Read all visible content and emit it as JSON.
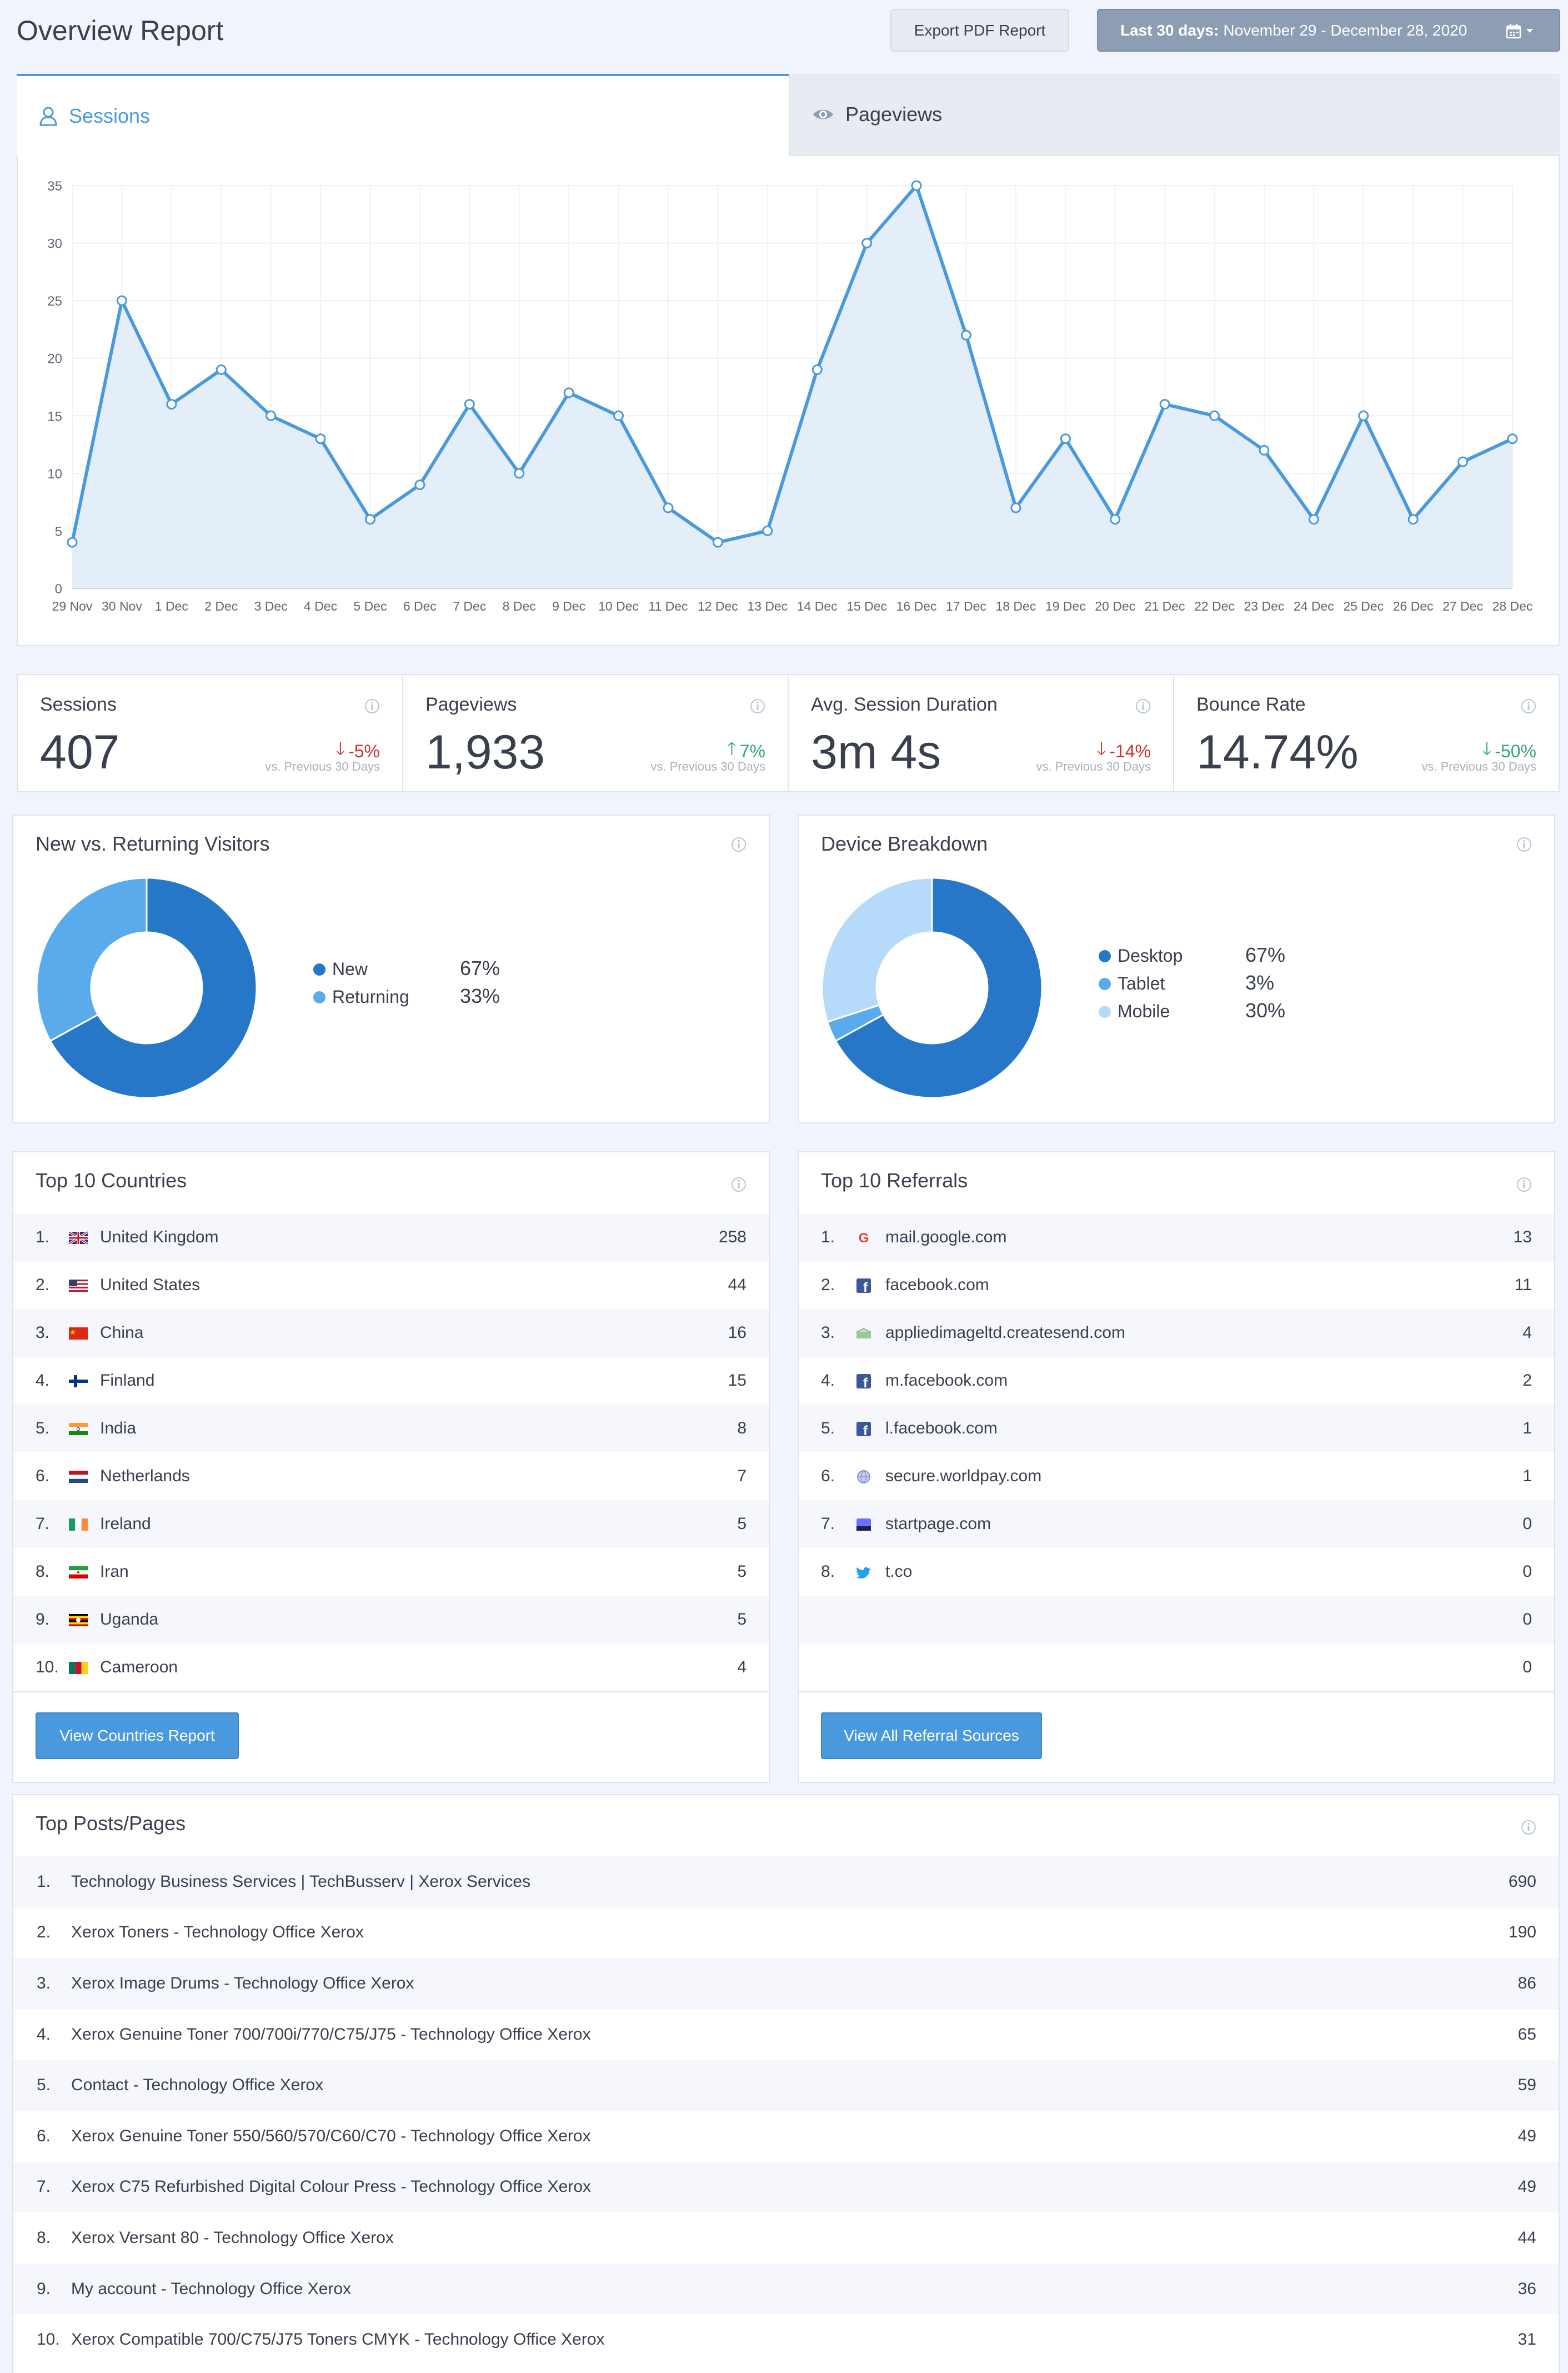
{
  "header": {
    "title": "Overview Report",
    "export_label": "Export PDF Report",
    "range_label": "Last 30 days:",
    "range_value": "November 29 - December 28, 2020"
  },
  "tabs": {
    "sessions": "Sessions",
    "pageviews": "Pageviews"
  },
  "colors": {
    "accent": "#4a99dd",
    "primary_blue": "#2677c7",
    "mid_blue": "#5aabeb",
    "light_blue": "#b6dbfa",
    "down": "#d0312d",
    "up": "#36a673"
  },
  "chart_data": {
    "type": "area",
    "x": [
      "29 Nov",
      "30 Nov",
      "1 Dec",
      "2 Dec",
      "3 Dec",
      "4 Dec",
      "5 Dec",
      "6 Dec",
      "7 Dec",
      "8 Dec",
      "9 Dec",
      "10 Dec",
      "11 Dec",
      "12 Dec",
      "13 Dec",
      "14 Dec",
      "15 Dec",
      "16 Dec",
      "17 Dec",
      "18 Dec",
      "19 Dec",
      "20 Dec",
      "21 Dec",
      "22 Dec",
      "23 Dec",
      "24 Dec",
      "25 Dec",
      "26 Dec",
      "27 Dec",
      "28 Dec"
    ],
    "series": [
      {
        "values": [
          4,
          25,
          16,
          19,
          15,
          13,
          6,
          9,
          16,
          10,
          17,
          15,
          7,
          4,
          5,
          19,
          30,
          35,
          22,
          7,
          13,
          6,
          16,
          15,
          12,
          6,
          15,
          6,
          11,
          13
        ]
      }
    ],
    "yticks": [
      0,
      5,
      10,
      15,
      20,
      25,
      30,
      35
    ],
    "ylim": [
      0,
      35
    ],
    "grid": true
  },
  "stats": [
    {
      "label": "Sessions",
      "value": "407",
      "delta": "-5%",
      "direction": "down",
      "compare": "vs. Previous 30 Days"
    },
    {
      "label": "Pageviews",
      "value": "1,933",
      "delta": "7%",
      "direction": "up",
      "compare": "vs. Previous 30 Days"
    },
    {
      "label": "Avg. Session Duration",
      "value": "3m 4s",
      "delta": "-14%",
      "direction": "down",
      "compare": "vs. Previous 30 Days"
    },
    {
      "label": "Bounce Rate",
      "value": "14.74%",
      "delta": "-50%",
      "direction": "up",
      "compare": "vs. Previous 30 Days"
    }
  ],
  "visitors": {
    "title": "New vs. Returning Visitors",
    "items": [
      {
        "label": "New",
        "value": 67,
        "display": "67%",
        "color": "#2677c7"
      },
      {
        "label": "Returning",
        "value": 33,
        "display": "33%",
        "color": "#5aabeb"
      }
    ]
  },
  "devices": {
    "title": "Device Breakdown",
    "items": [
      {
        "label": "Desktop",
        "value": 67,
        "display": "67%",
        "color": "#2677c7"
      },
      {
        "label": "Tablet",
        "value": 3,
        "display": "3%",
        "color": "#5aabeb"
      },
      {
        "label": "Mobile",
        "value": 30,
        "display": "30%",
        "color": "#b6dbfa"
      }
    ]
  },
  "countries": {
    "title": "Top 10 Countries",
    "button": "View Countries Report",
    "rows": [
      {
        "num": "1.",
        "name": "United Kingdom",
        "count": "258",
        "flag": "uk-flag-icon"
      },
      {
        "num": "2.",
        "name": "United States",
        "count": "44",
        "flag": "us-flag-icon"
      },
      {
        "num": "3.",
        "name": "China",
        "count": "16",
        "flag": "china-flag-icon"
      },
      {
        "num": "4.",
        "name": "Finland",
        "count": "15",
        "flag": "finland-flag-icon"
      },
      {
        "num": "5.",
        "name": "India",
        "count": "8",
        "flag": "india-flag-icon"
      },
      {
        "num": "6.",
        "name": "Netherlands",
        "count": "7",
        "flag": "netherlands-flag-icon"
      },
      {
        "num": "7.",
        "name": "Ireland",
        "count": "5",
        "flag": "ireland-flag-icon"
      },
      {
        "num": "8.",
        "name": "Iran",
        "count": "5",
        "flag": "iran-flag-icon"
      },
      {
        "num": "9.",
        "name": "Uganda",
        "count": "5",
        "flag": "uganda-flag-icon"
      },
      {
        "num": "10.",
        "name": "Cameroon",
        "count": "4",
        "flag": "cameroon-flag-icon"
      }
    ]
  },
  "referrals": {
    "title": "Top 10 Referrals",
    "button": "View All Referral Sources",
    "rows": [
      {
        "num": "1.",
        "name": "mail.google.com",
        "count": "13",
        "icon": "google-icon"
      },
      {
        "num": "2.",
        "name": "facebook.com",
        "count": "11",
        "icon": "facebook-icon"
      },
      {
        "num": "3.",
        "name": "appliedimageltd.createsend.com",
        "count": "4",
        "icon": "createsend-icon"
      },
      {
        "num": "4.",
        "name": "m.facebook.com",
        "count": "2",
        "icon": "facebook-icon"
      },
      {
        "num": "5.",
        "name": "l.facebook.com",
        "count": "1",
        "icon": "facebook-icon"
      },
      {
        "num": "6.",
        "name": "secure.worldpay.com",
        "count": "1",
        "icon": "globe-icon"
      },
      {
        "num": "7.",
        "name": "startpage.com",
        "count": "0",
        "icon": "startpage-icon"
      },
      {
        "num": "8.",
        "name": "t.co",
        "count": "0",
        "icon": "twitter-icon"
      },
      {
        "num": "",
        "name": "",
        "count": "0",
        "icon": ""
      },
      {
        "num": "",
        "name": "",
        "count": "0",
        "icon": ""
      }
    ]
  },
  "posts": {
    "title": "Top Posts/Pages",
    "rows": [
      {
        "num": "1.",
        "name": "Technology Business Services | TechBusserv | Xerox Services",
        "count": "690"
      },
      {
        "num": "2.",
        "name": "Xerox Toners - Technology Office Xerox",
        "count": "190"
      },
      {
        "num": "3.",
        "name": "Xerox Image Drums - Technology Office Xerox",
        "count": "86"
      },
      {
        "num": "4.",
        "name": "Xerox Genuine Toner 700/700i/770/C75/J75 - Technology Office Xerox",
        "count": "65"
      },
      {
        "num": "5.",
        "name": "Contact - Technology Office Xerox",
        "count": "59"
      },
      {
        "num": "6.",
        "name": "Xerox Genuine Toner 550/560/570/C60/C70 - Technology Office Xerox",
        "count": "49"
      },
      {
        "num": "7.",
        "name": "Xerox C75 Refurbished Digital Colour Press - Technology Office Xerox",
        "count": "49"
      },
      {
        "num": "8.",
        "name": "Xerox Versant 80 - Technology Office Xerox",
        "count": "44"
      },
      {
        "num": "9.",
        "name": "My account - Technology Office Xerox",
        "count": "36"
      },
      {
        "num": "10.",
        "name": "Xerox Compatible 700/C75/J75 Toners CMYK - Technology Office Xerox",
        "count": "31"
      }
    ]
  }
}
